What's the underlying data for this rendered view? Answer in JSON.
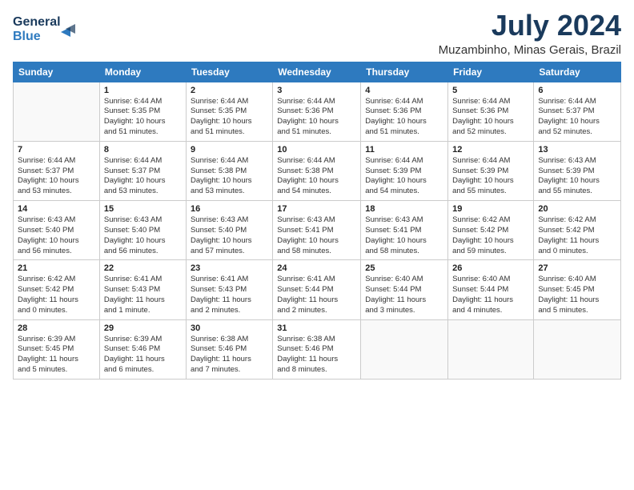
{
  "header": {
    "logo_line1": "General",
    "logo_line2": "Blue",
    "month": "July 2024",
    "location": "Muzambinho, Minas Gerais, Brazil"
  },
  "weekdays": [
    "Sunday",
    "Monday",
    "Tuesday",
    "Wednesday",
    "Thursday",
    "Friday",
    "Saturday"
  ],
  "weeks": [
    [
      {
        "day": "",
        "info": ""
      },
      {
        "day": "1",
        "info": "Sunrise: 6:44 AM\nSunset: 5:35 PM\nDaylight: 10 hours\nand 51 minutes."
      },
      {
        "day": "2",
        "info": "Sunrise: 6:44 AM\nSunset: 5:35 PM\nDaylight: 10 hours\nand 51 minutes."
      },
      {
        "day": "3",
        "info": "Sunrise: 6:44 AM\nSunset: 5:36 PM\nDaylight: 10 hours\nand 51 minutes."
      },
      {
        "day": "4",
        "info": "Sunrise: 6:44 AM\nSunset: 5:36 PM\nDaylight: 10 hours\nand 51 minutes."
      },
      {
        "day": "5",
        "info": "Sunrise: 6:44 AM\nSunset: 5:36 PM\nDaylight: 10 hours\nand 52 minutes."
      },
      {
        "day": "6",
        "info": "Sunrise: 6:44 AM\nSunset: 5:37 PM\nDaylight: 10 hours\nand 52 minutes."
      }
    ],
    [
      {
        "day": "7",
        "info": "Sunrise: 6:44 AM\nSunset: 5:37 PM\nDaylight: 10 hours\nand 53 minutes."
      },
      {
        "day": "8",
        "info": "Sunrise: 6:44 AM\nSunset: 5:37 PM\nDaylight: 10 hours\nand 53 minutes."
      },
      {
        "day": "9",
        "info": "Sunrise: 6:44 AM\nSunset: 5:38 PM\nDaylight: 10 hours\nand 53 minutes."
      },
      {
        "day": "10",
        "info": "Sunrise: 6:44 AM\nSunset: 5:38 PM\nDaylight: 10 hours\nand 54 minutes."
      },
      {
        "day": "11",
        "info": "Sunrise: 6:44 AM\nSunset: 5:39 PM\nDaylight: 10 hours\nand 54 minutes."
      },
      {
        "day": "12",
        "info": "Sunrise: 6:44 AM\nSunset: 5:39 PM\nDaylight: 10 hours\nand 55 minutes."
      },
      {
        "day": "13",
        "info": "Sunrise: 6:43 AM\nSunset: 5:39 PM\nDaylight: 10 hours\nand 55 minutes."
      }
    ],
    [
      {
        "day": "14",
        "info": "Sunrise: 6:43 AM\nSunset: 5:40 PM\nDaylight: 10 hours\nand 56 minutes."
      },
      {
        "day": "15",
        "info": "Sunrise: 6:43 AM\nSunset: 5:40 PM\nDaylight: 10 hours\nand 56 minutes."
      },
      {
        "day": "16",
        "info": "Sunrise: 6:43 AM\nSunset: 5:40 PM\nDaylight: 10 hours\nand 57 minutes."
      },
      {
        "day": "17",
        "info": "Sunrise: 6:43 AM\nSunset: 5:41 PM\nDaylight: 10 hours\nand 58 minutes."
      },
      {
        "day": "18",
        "info": "Sunrise: 6:43 AM\nSunset: 5:41 PM\nDaylight: 10 hours\nand 58 minutes."
      },
      {
        "day": "19",
        "info": "Sunrise: 6:42 AM\nSunset: 5:42 PM\nDaylight: 10 hours\nand 59 minutes."
      },
      {
        "day": "20",
        "info": "Sunrise: 6:42 AM\nSunset: 5:42 PM\nDaylight: 11 hours\nand 0 minutes."
      }
    ],
    [
      {
        "day": "21",
        "info": "Sunrise: 6:42 AM\nSunset: 5:42 PM\nDaylight: 11 hours\nand 0 minutes."
      },
      {
        "day": "22",
        "info": "Sunrise: 6:41 AM\nSunset: 5:43 PM\nDaylight: 11 hours\nand 1 minute."
      },
      {
        "day": "23",
        "info": "Sunrise: 6:41 AM\nSunset: 5:43 PM\nDaylight: 11 hours\nand 2 minutes."
      },
      {
        "day": "24",
        "info": "Sunrise: 6:41 AM\nSunset: 5:44 PM\nDaylight: 11 hours\nand 2 minutes."
      },
      {
        "day": "25",
        "info": "Sunrise: 6:40 AM\nSunset: 5:44 PM\nDaylight: 11 hours\nand 3 minutes."
      },
      {
        "day": "26",
        "info": "Sunrise: 6:40 AM\nSunset: 5:44 PM\nDaylight: 11 hours\nand 4 minutes."
      },
      {
        "day": "27",
        "info": "Sunrise: 6:40 AM\nSunset: 5:45 PM\nDaylight: 11 hours\nand 5 minutes."
      }
    ],
    [
      {
        "day": "28",
        "info": "Sunrise: 6:39 AM\nSunset: 5:45 PM\nDaylight: 11 hours\nand 5 minutes."
      },
      {
        "day": "29",
        "info": "Sunrise: 6:39 AM\nSunset: 5:46 PM\nDaylight: 11 hours\nand 6 minutes."
      },
      {
        "day": "30",
        "info": "Sunrise: 6:38 AM\nSunset: 5:46 PM\nDaylight: 11 hours\nand 7 minutes."
      },
      {
        "day": "31",
        "info": "Sunrise: 6:38 AM\nSunset: 5:46 PM\nDaylight: 11 hours\nand 8 minutes."
      },
      {
        "day": "",
        "info": ""
      },
      {
        "day": "",
        "info": ""
      },
      {
        "day": "",
        "info": ""
      }
    ]
  ]
}
